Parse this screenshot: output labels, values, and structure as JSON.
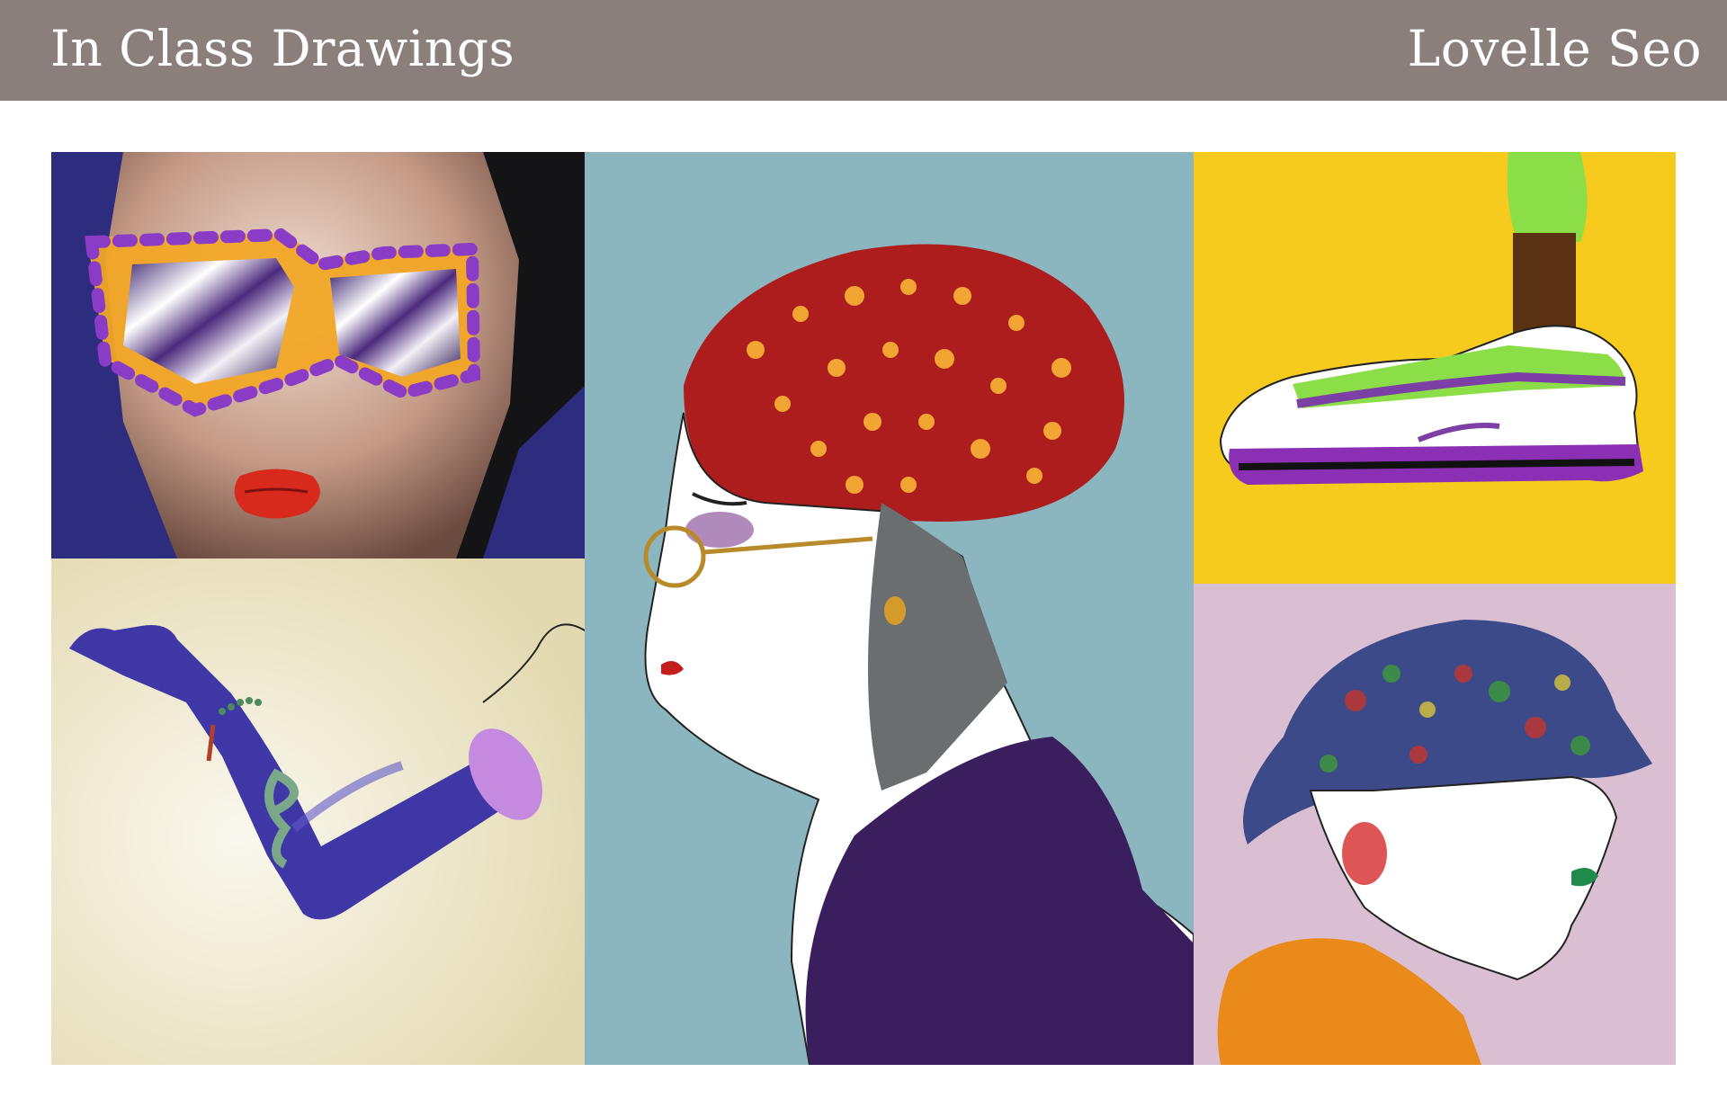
{
  "header": {
    "title": "In Class Drawings",
    "author": "Lovelle Seo",
    "background_color": "#8b7f7c"
  },
  "panels": [
    {
      "name": "sunglasses-portrait",
      "background_color": "#2e2c7e"
    },
    {
      "name": "gloved-arm",
      "background_color": "#e7dfba"
    },
    {
      "name": "leopard-beret-profile",
      "background_color": "#8cb6bf"
    },
    {
      "name": "sneaker",
      "background_color": "#f7cb1d"
    },
    {
      "name": "bucket-hat-profile",
      "background_color": "#d9bfd1"
    }
  ]
}
